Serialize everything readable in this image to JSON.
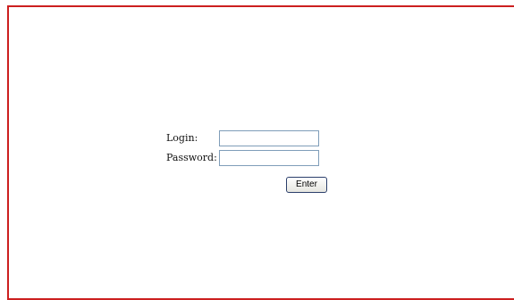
{
  "login_form": {
    "login_label": "Login:",
    "login_value": "",
    "password_label": "Password:",
    "password_value": "",
    "enter_label": "Enter"
  },
  "colors": {
    "frame_border": "#cc1f1f",
    "field_border": "#7f9db9",
    "button_border": "#2b3f6b"
  }
}
